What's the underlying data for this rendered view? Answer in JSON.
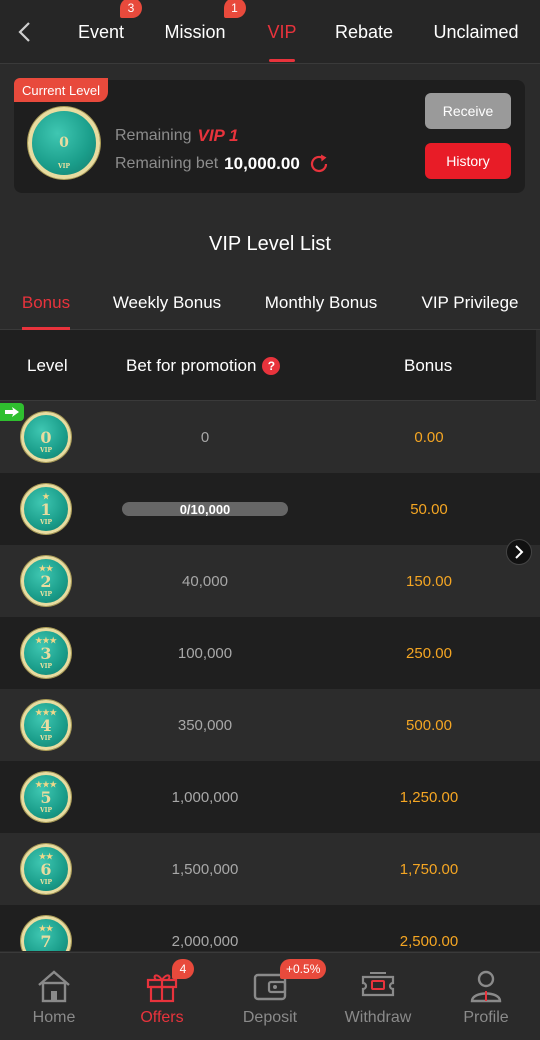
{
  "nav": {
    "tabs": [
      {
        "label": "Event",
        "badge": "3"
      },
      {
        "label": "Mission",
        "badge": "1"
      },
      {
        "label": "VIP",
        "badge": ""
      },
      {
        "label": "Rebate",
        "badge": ""
      },
      {
        "label": "Unclaimed",
        "badge": ""
      }
    ],
    "active_tab": "VIP"
  },
  "current_level": {
    "tag": "Current Level",
    "medal_number": "0",
    "remaining_label": "Remaining",
    "remaining_vip": "VIP 1",
    "remaining_bet_label": "Remaining bet",
    "remaining_bet": "10,000.00",
    "receive_label": "Receive",
    "history_label": "History"
  },
  "list": {
    "title": "VIP Level List",
    "tabs": [
      "Bonus",
      "Weekly Bonus",
      "Monthly Bonus",
      "VIP Privilege"
    ],
    "active_tab": "Bonus",
    "headers": {
      "level": "Level",
      "bet": "Bet for promotion",
      "bonus": "Bonus"
    },
    "rows": [
      {
        "level": "0",
        "stars": 0,
        "bet": "0",
        "bonus": "0.00"
      },
      {
        "level": "1",
        "stars": 1,
        "bet": "0/10,000",
        "progress": 0,
        "bonus": "50.00"
      },
      {
        "level": "2",
        "stars": 2,
        "bet": "40,000",
        "bonus": "150.00"
      },
      {
        "level": "3",
        "stars": 3,
        "bet": "100,000",
        "bonus": "250.00"
      },
      {
        "level": "4",
        "stars": 3,
        "bet": "350,000",
        "bonus": "500.00"
      },
      {
        "level": "5",
        "stars": 3,
        "bet": "1,000,000",
        "bonus": "1,250.00"
      },
      {
        "level": "6",
        "stars": 2,
        "bet": "1,500,000",
        "bonus": "1,750.00"
      },
      {
        "level": "7",
        "stars": 2,
        "bet": "2,000,000",
        "bonus": "2,500.00"
      }
    ]
  },
  "bottom": {
    "items": [
      {
        "label": "Home",
        "icon": "home-icon",
        "badge": ""
      },
      {
        "label": "Offers",
        "icon": "gift-icon",
        "badge": "4"
      },
      {
        "label": "Deposit",
        "icon": "wallet-icon",
        "badge": "+0.5%"
      },
      {
        "label": "Withdraw",
        "icon": "ticket-icon",
        "badge": ""
      },
      {
        "label": "Profile",
        "icon": "user-icon",
        "badge": ""
      }
    ],
    "active": "Offers"
  },
  "colors": {
    "accent": "#e8333c",
    "bonus": "#f5a623",
    "background": "#2b2b2b"
  }
}
